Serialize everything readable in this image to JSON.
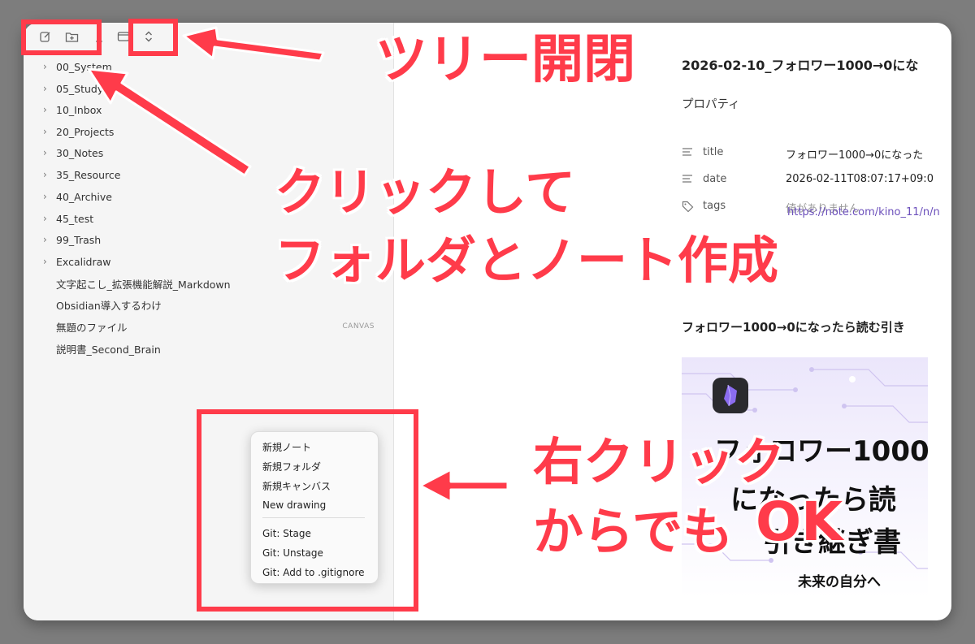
{
  "toolbar": {
    "icons": [
      "new-note-icon",
      "new-folder-icon",
      "sort-icon",
      "collapse-icon",
      "expand-collapse-icon"
    ]
  },
  "sidebar": {
    "folders": [
      {
        "label": "00_System"
      },
      {
        "label": "05_Study"
      },
      {
        "label": "10_Inbox"
      },
      {
        "label": "20_Projects"
      },
      {
        "label": "30_Notes"
      },
      {
        "label": "35_Resource"
      },
      {
        "label": "40_Archive"
      },
      {
        "label": "45_test"
      },
      {
        "label": "99_Trash"
      },
      {
        "label": "Excalidraw"
      }
    ],
    "files": [
      {
        "label": "文字起こし_拡張機能解説_Markdown",
        "badge": ""
      },
      {
        "label": "Obsidian導入するわけ",
        "badge": ""
      },
      {
        "label": "無題のファイル",
        "badge": "CANVAS"
      },
      {
        "label": "説明書_Second_Brain",
        "badge": ""
      }
    ]
  },
  "context_menu": {
    "items": [
      "新規ノート",
      "新規フォルダ",
      "新規キャンバス",
      "New drawing",
      "Git: Stage",
      "Git: Unstage",
      "Git: Add to .gitignore"
    ]
  },
  "document": {
    "title": "2026-02-10_フォロワー1000→0にな",
    "properties_heading": "プロパティ",
    "properties": [
      {
        "key": "title",
        "value": "フォロワー1000→0になった",
        "icon": "text-lines-icon"
      },
      {
        "key": "date",
        "value": "2026-02-11T08:07:17+09:0",
        "icon": "text-lines-icon"
      },
      {
        "key": "tags",
        "value": "値がありません",
        "icon": "tag-icon"
      }
    ],
    "link": "https://note.com/kino_11/n/n",
    "section_heading": "フォロワー1000→0になったら読む引き",
    "banner": {
      "line1": "フォロワー1000",
      "line2": "になったら読",
      "line3": "引き継ぎ書",
      "footer": "未来の自分へ"
    }
  },
  "annotations": {
    "tree_toggle": "ツリー開閉",
    "create_line1": "クリックして",
    "create_line2": "フォルダとノート作成",
    "right_click_line1": "右クリック",
    "right_click_line2": "からでも",
    "ok": "OK",
    "accent_color": "#ff3b4a"
  }
}
